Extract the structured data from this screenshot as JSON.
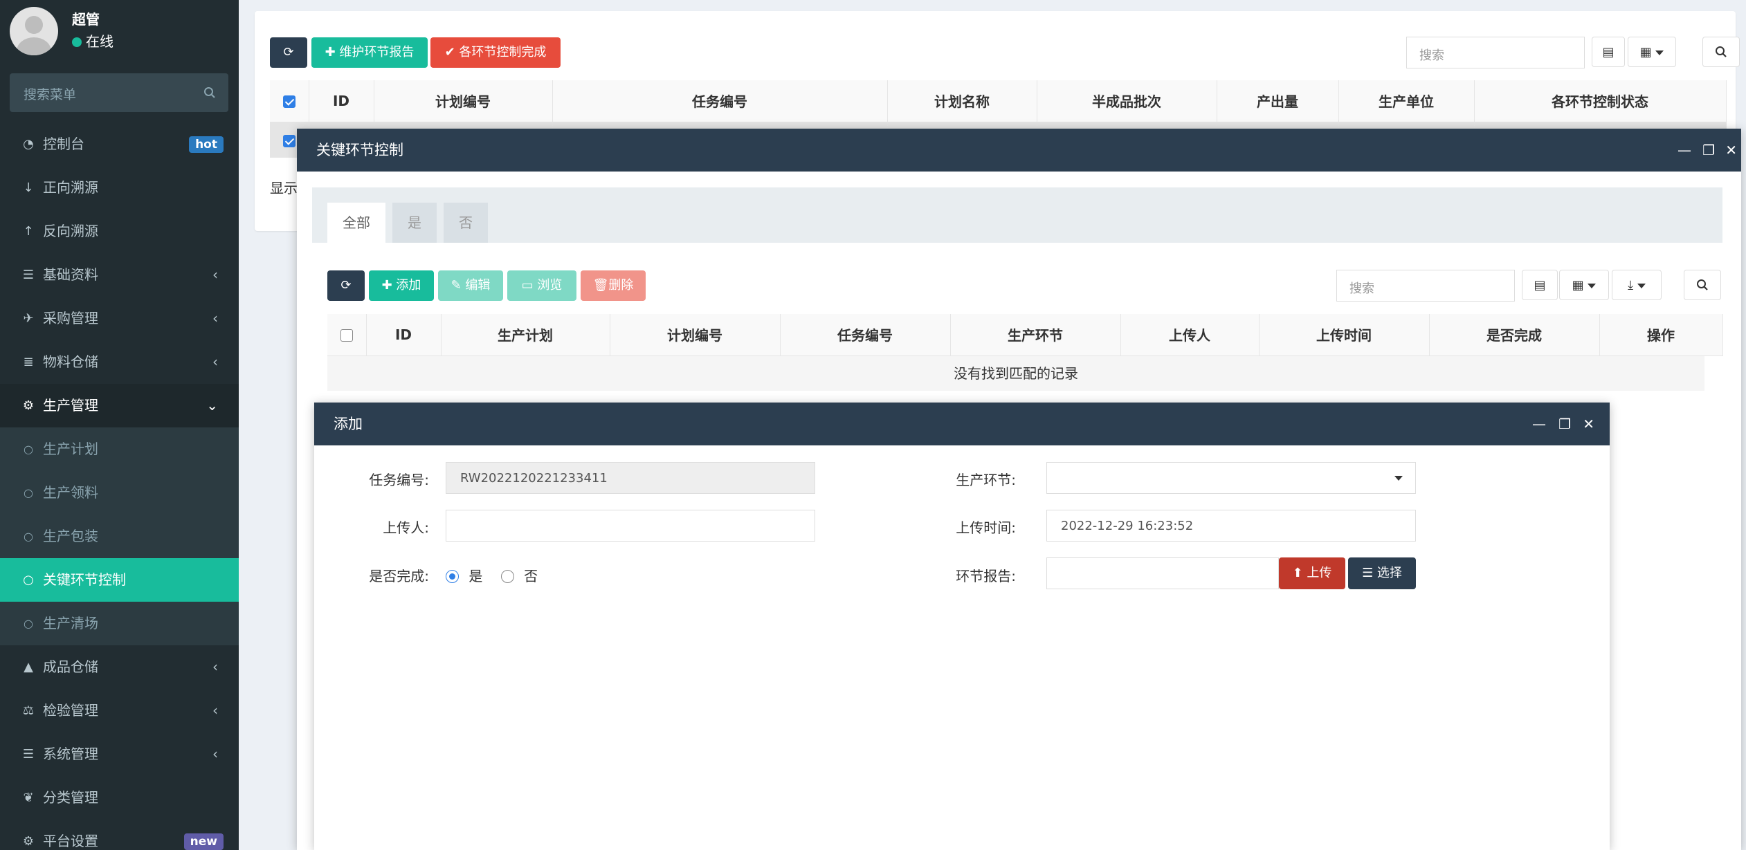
{
  "sidebar": {
    "user_name": "超管",
    "user_status": "在线",
    "search_placeholder": "搜索菜单",
    "items": [
      {
        "label": "控制台",
        "icon": "dashboard-icon",
        "badge": "hot"
      },
      {
        "label": "正向溯源",
        "icon": "arrow-down-icon"
      },
      {
        "label": "反向溯源",
        "icon": "arrow-up-icon"
      },
      {
        "label": "基础资料",
        "icon": "list-icon"
      },
      {
        "label": "采购管理",
        "icon": "plane-icon"
      },
      {
        "label": "物料仓储",
        "icon": "database-icon"
      },
      {
        "label": "生产管理",
        "icon": "cogs-icon"
      },
      {
        "label": "生产计划",
        "icon": "circle-icon"
      },
      {
        "label": "生产领料",
        "icon": "circle-icon"
      },
      {
        "label": "生产包装",
        "icon": "circle-icon"
      },
      {
        "label": "关键环节控制",
        "icon": "circle-icon"
      },
      {
        "label": "生产清场",
        "icon": "circle-icon"
      },
      {
        "label": "成品仓储",
        "icon": "road-icon"
      },
      {
        "label": "检验管理",
        "icon": "balance-icon"
      },
      {
        "label": "系统管理",
        "icon": "list-icon"
      },
      {
        "label": "分类管理",
        "icon": "leaf-icon"
      },
      {
        "label": "平台设置",
        "icon": "cogs-icon",
        "badge": "new"
      }
    ]
  },
  "main": {
    "btn_maintain": "维护环节报告",
    "btn_complete": "各环节控制完成",
    "search_placeholder": "搜索",
    "columns": [
      "ID",
      "计划编号",
      "任务编号",
      "计划名称",
      "半成品批次",
      "产出量",
      "生产单位",
      "各环节控制状态"
    ],
    "footer_text": "显示"
  },
  "layer1": {
    "title": "关键环节控制",
    "tabs": [
      "全部",
      "是",
      "否"
    ],
    "btn_add": "添加",
    "btn_edit": "编辑",
    "btn_browse": "浏览",
    "btn_delete": "删除",
    "search_placeholder": "搜索",
    "columns": [
      "ID",
      "生产计划",
      "计划编号",
      "任务编号",
      "生产环节",
      "上传人",
      "上传时间",
      "是否完成",
      "操作"
    ],
    "empty_text": "没有找到匹配的记录"
  },
  "add_form": {
    "title": "添加",
    "task_no_label": "任务编号:",
    "task_no_value": "RW2022120221233411",
    "stage_label": "生产环节:",
    "stage_value": "",
    "uploader_label": "上传人:",
    "uploader_value": "",
    "upload_time_label": "上传时间:",
    "upload_time_value": "2022-12-29 16:23:52",
    "done_label": "是否完成:",
    "done_yes": "是",
    "done_no": "否",
    "done_selected": "是",
    "report_label": "环节报告:",
    "btn_upload": "上传",
    "btn_choose": "选择"
  },
  "colors": {
    "sidebar_bg": "#222d32",
    "accent_green": "#18bc9c",
    "danger_red": "#e74c3c",
    "title_bar": "#2c3e50"
  }
}
